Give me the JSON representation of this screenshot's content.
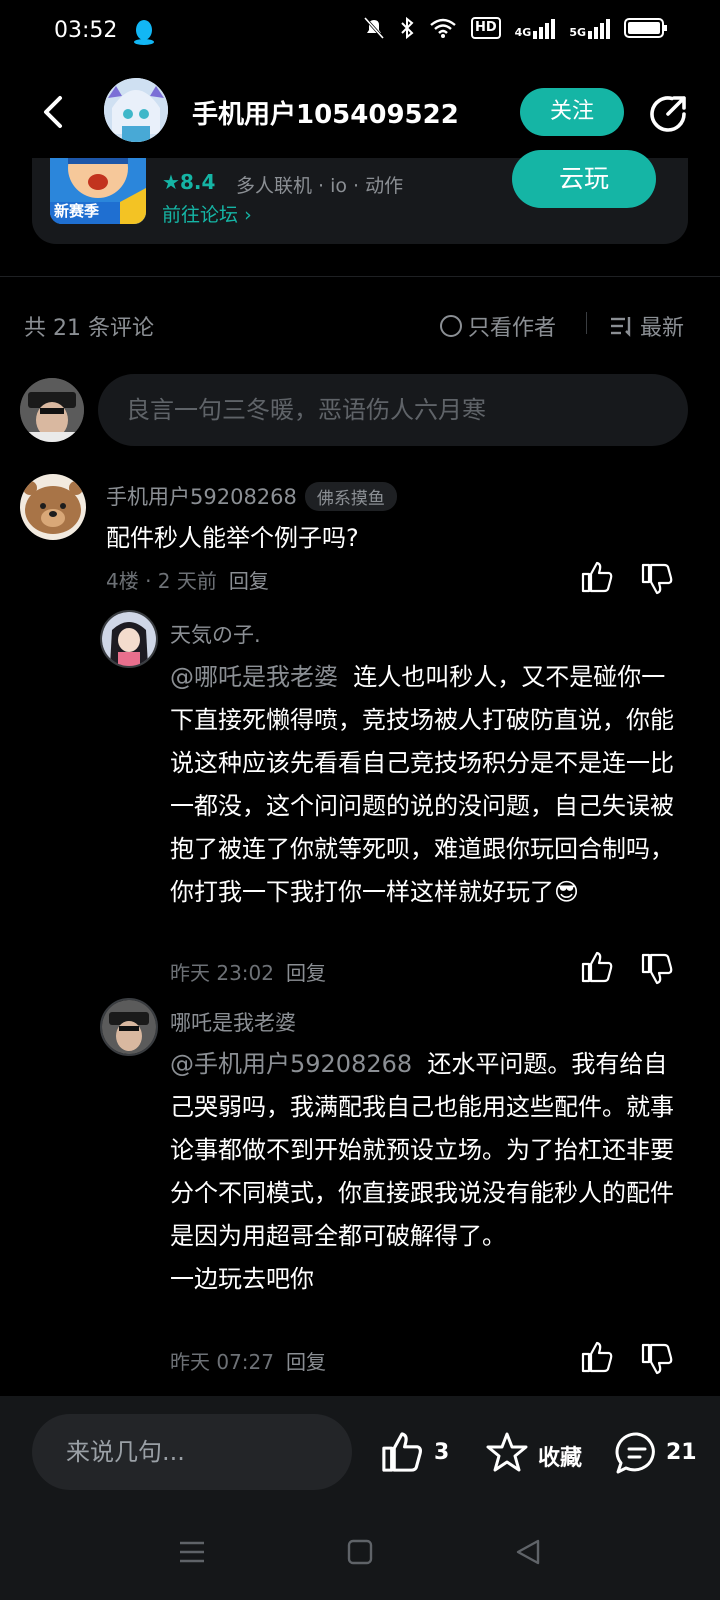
{
  "status_bar": {
    "time": "03:52",
    "hd_label": "HD",
    "net1": "4G",
    "net2": "5G"
  },
  "header": {
    "username": "手机用户105409522",
    "follow_label": "关注"
  },
  "game_card": {
    "rating": "8.4",
    "tags": "多人联机 · io · 动作",
    "forum_link": "前往论坛",
    "cloud_play_label": "云玩",
    "icon_text": "新赛季"
  },
  "comments_meta": {
    "count_text": "共 21 条评论",
    "author_only_label": "只看作者",
    "sort_label": "最新",
    "input_placeholder": "良言一句三冬暖，恶语伤人六月寒"
  },
  "comment": {
    "user": "手机用户59208268",
    "badge": "佛系摸鱼",
    "text": "配件秒人能举个例子吗?",
    "meta": "4楼 · 2 天前",
    "reply_label": "回复"
  },
  "replies": [
    {
      "user": "天気の子.",
      "mention": "@哪吒是我老婆",
      "text": "连人也叫秒人，又不是碰你一下直接死懒得喷，竞技场被人打破防直说，你能说这种应该先看看自己竞技场积分是不是连一比一都没，这个问问题的说的没问题，自己失误被抱了被连了你就等死呗，难道跟你玩回合制吗，你打我一下我打你一样这样就好玩了",
      "emoji": "😎",
      "time": "昨天 23:02",
      "reply_label": "回复"
    },
    {
      "user": "哪吒是我老婆",
      "mention": "@手机用户59208268",
      "text": "还水平问题。我有给自己哭弱吗，我满配我自己也能用这些配件。就事论事都做不到开始就预设立场。为了抬杠还非要分个不同模式，你直接跟我说没有能秒人的配件是因为用超哥全都可破解得了。",
      "text2": "一边玩去吧你",
      "time": "昨天 07:27",
      "reply_label": "回复"
    }
  ],
  "bottom_bar": {
    "input_placeholder": "来说几句...",
    "like_count": "3",
    "favorite_label": "收藏",
    "reply_count": "21"
  },
  "colors": {
    "accent": "#15b5a5",
    "background": "#000000",
    "muted": "#8b8f94"
  }
}
